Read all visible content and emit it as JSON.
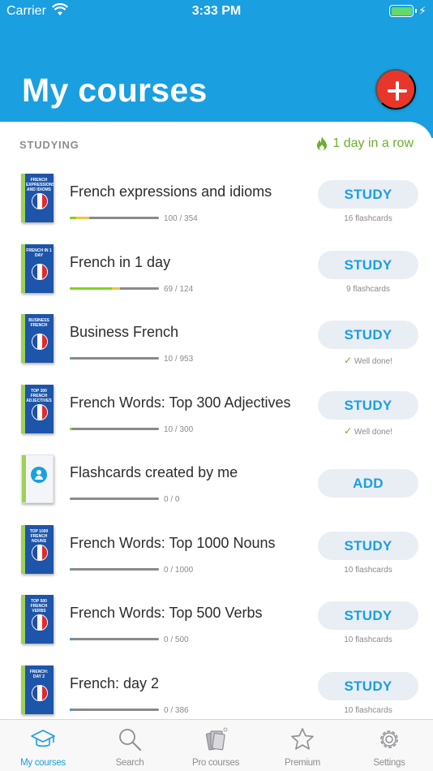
{
  "status_bar": {
    "carrier": "Carrier",
    "time": "3:33 PM",
    "battery_color": "#64d86b"
  },
  "header": {
    "title": "My courses",
    "background": "#1a9fe0",
    "add_icon": "plus-icon"
  },
  "section": {
    "label": "STUDYING",
    "streak": "1 day in a row",
    "streak_icon": "flame-icon"
  },
  "courses": [
    {
      "title": "French expressions and idioms",
      "progress_text": "100 / 354",
      "action": "STUDY",
      "status": "16 flashcards",
      "known": 0.07,
      "learning": 0.22,
      "cover": "FRENCH EXPRESSIONS AND IDIOMS"
    },
    {
      "title": "French in 1 day",
      "progress_text": "69 / 124",
      "action": "STUDY",
      "status": "9 flashcards",
      "known": 0.47,
      "learning": 0.56,
      "cover": "FRENCH IN 1 DAY"
    },
    {
      "title": "Business French",
      "progress_text": "10 / 953",
      "action": "STUDY",
      "status": "Well done!",
      "known": 0,
      "learning": 0.01,
      "cover": "BUSINESS FRENCH"
    },
    {
      "title": "French Words: Top 300 Adjectives",
      "progress_text": "10 / 300",
      "action": "STUDY",
      "status": "Well done!",
      "known": 0.03,
      "learning": 0.03,
      "cover": "TOP 300 FRENCH ADJECTIVES"
    },
    {
      "title": "Flashcards created by me",
      "progress_text": "0 / 0",
      "action": "ADD",
      "status": "",
      "known": 0,
      "learning": 0,
      "cover": ""
    },
    {
      "title": "French Words: Top 1000 Nouns",
      "progress_text": "0 / 1000",
      "action": "STUDY",
      "status": "10 flashcards",
      "known": 0,
      "learning": 0.01,
      "cover": "TOP 1000 FRENCH NOUNS"
    },
    {
      "title": "French Words: Top 500 Verbs",
      "progress_text": "0 / 500",
      "action": "STUDY",
      "status": "10 flashcards",
      "known": 0,
      "learning": 0.02,
      "cover": "TOP 500 FRENCH VERBS"
    },
    {
      "title": "French: day 2",
      "progress_text": "0 / 386",
      "action": "STUDY",
      "status": "10 flashcards",
      "known": 0,
      "learning": 0.02,
      "cover": "FRENCH: DAY 2"
    }
  ],
  "tabs": [
    {
      "label": "My courses",
      "icon": "graduation-cap-icon",
      "active": true
    },
    {
      "label": "Search",
      "icon": "search-icon",
      "active": false
    },
    {
      "label": "Pro courses",
      "icon": "cards-icon",
      "active": false
    },
    {
      "label": "Premium",
      "icon": "star-icon",
      "active": false
    },
    {
      "label": "Settings",
      "icon": "gear-icon",
      "active": false
    }
  ],
  "colors": {
    "accent": "#1a9fe0",
    "add_button": "#e8372a",
    "success": "#6cae2d",
    "progress_green": "#7ed321",
    "progress_yellow": "#f5c23a"
  }
}
